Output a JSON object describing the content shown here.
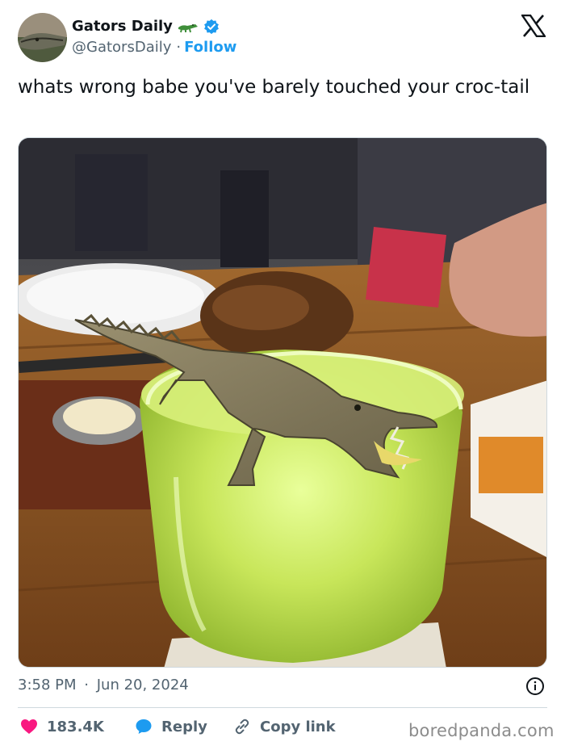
{
  "account": {
    "display_name": "Gators Daily",
    "handle": "@GatorsDaily",
    "separator": "·",
    "follow_label": "Follow",
    "emoji_icon": "crocodile-emoji",
    "verified_icon": "verified-badge-icon"
  },
  "tweet": {
    "text": "whats wrong babe you've barely touched your croc-tail",
    "time": "3:58 PM",
    "date_separator": "·",
    "date": "Jun 20, 2024"
  },
  "actions": {
    "like_count": "183.4K",
    "reply_label": "Reply",
    "copy_label": "Copy link"
  },
  "watermark": "boredpanda.com",
  "colors": {
    "accent": "#1d9bf0",
    "like": "#f91880",
    "text": "#0f1419",
    "muted": "#536471"
  }
}
